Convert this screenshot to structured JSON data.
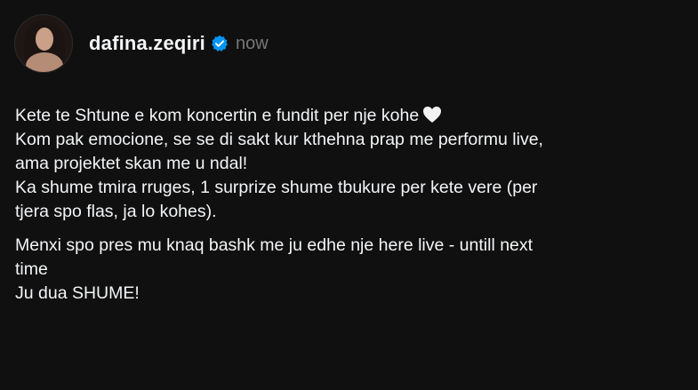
{
  "post": {
    "username": "dafina.zeqiri",
    "timestamp": "now",
    "verified_color": "#0095f6",
    "lines_block1": [
      "Kete te Shtune e kom koncertin e fundit per nje kohe",
      "Kom pak emocione, se se di sakt kur kthehna prap me performu live,",
      "ama projektet skan me u ndal!",
      "Ka shume tmira rruges, 1 surprize shume tbukure per kete vere (per",
      "tjera spo flas, ja lo kohes)."
    ],
    "lines_block2": [
      "Menxi spo pres mu knaq bashk me ju edhe nje here live - untill next",
      "time",
      "Ju dua SHUME!"
    ],
    "emoji": "white-heart-icon"
  }
}
